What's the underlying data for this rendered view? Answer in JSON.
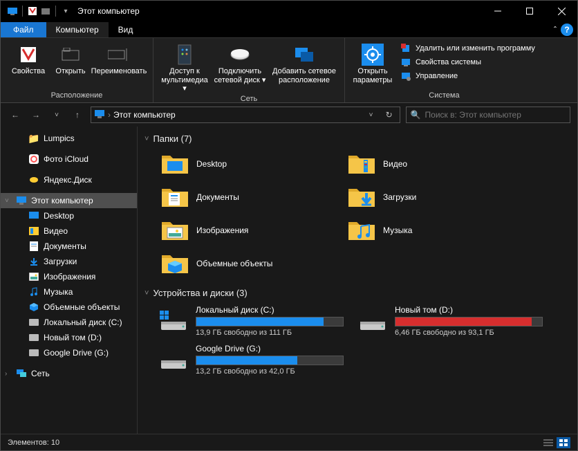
{
  "window_title": "Этот компьютер",
  "tabs": {
    "file": "Файл",
    "computer": "Компьютер",
    "view": "Вид"
  },
  "ribbon": {
    "location": {
      "label": "Расположение",
      "properties": "Свойства",
      "open": "Открыть",
      "rename": "Переименовать"
    },
    "network": {
      "label": "Сеть",
      "media_access": "Доступ к мультимедиа",
      "map_drive": "Подключить сетевой диск",
      "add_location": "Добавить сетевое расположение"
    },
    "system": {
      "label": "Система",
      "open_settings": "Открыть параметры",
      "uninstall": "Удалить или изменить программу",
      "system_props": "Свойства системы",
      "manage": "Управление"
    }
  },
  "breadcrumb": "Этот компьютер",
  "search_placeholder": "Поиск в: Этот компьютер",
  "sidebar": {
    "lumpics": "Lumpics",
    "icloud_photo": "Фото iCloud",
    "yandex_disk": "Яндекс.Диск",
    "this_pc": "Этот компьютер",
    "desktop": "Desktop",
    "video": "Видео",
    "documents": "Документы",
    "downloads": "Загрузки",
    "pictures": "Изображения",
    "music": "Музыка",
    "objects3d": "Объемные объекты",
    "local_disk_c": "Локальный диск (C:)",
    "new_volume_d": "Новый том (D:)",
    "google_drive": "Google Drive (G:)",
    "network": "Сеть"
  },
  "folders_section": "Папки (7)",
  "folders": [
    {
      "name": "Desktop",
      "icon": "desktop"
    },
    {
      "name": "Видео",
      "icon": "video"
    },
    {
      "name": "Документы",
      "icon": "documents"
    },
    {
      "name": "Загрузки",
      "icon": "downloads"
    },
    {
      "name": "Изображения",
      "icon": "pictures"
    },
    {
      "name": "Музыка",
      "icon": "music"
    },
    {
      "name": "Объемные объекты",
      "icon": "objects3d"
    }
  ],
  "drives_section": "Устройства и диски (3)",
  "drives": [
    {
      "name": "Локальный диск (C:)",
      "free": "13,9 ГБ свободно из 111 ГБ",
      "fill": 87,
      "color": "#1b8ded",
      "icon": "disk-win"
    },
    {
      "name": "Новый том (D:)",
      "free": "6,46 ГБ свободно из 93,1 ГБ",
      "fill": 93,
      "color": "#d62e2e",
      "icon": "disk"
    },
    {
      "name": "Google Drive (G:)",
      "free": "13,2 ГБ свободно из 42,0 ГБ",
      "fill": 69,
      "color": "#1b8ded",
      "icon": "disk"
    }
  ],
  "status": "Элементов: 10"
}
